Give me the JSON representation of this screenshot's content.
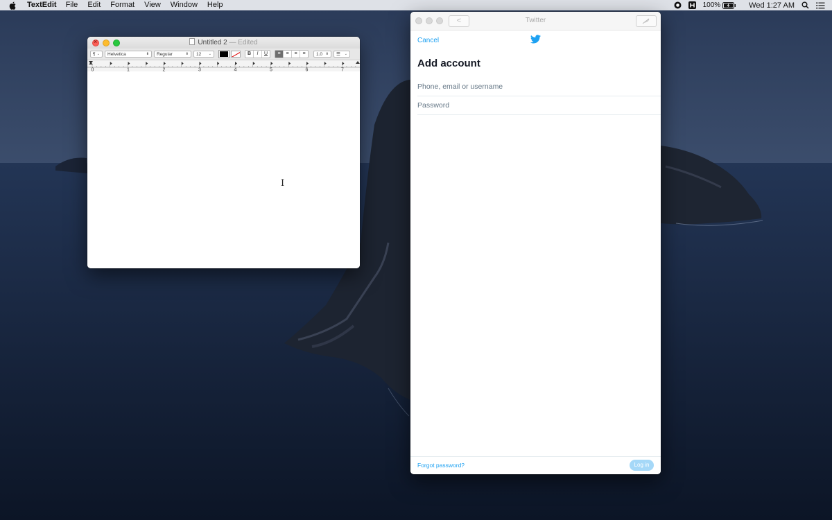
{
  "menubar": {
    "apple_icon": "apple-logo-icon",
    "app_name": "TextEdit",
    "items": [
      "File",
      "Edit",
      "Format",
      "View",
      "Window",
      "Help"
    ],
    "status_icons": [
      "screen-record-icon",
      "app-h-icon"
    ],
    "battery_percent": "100%",
    "battery_icon": "battery-charging-icon",
    "clock": "Wed 1:27 AM",
    "search_icon": "spotlight-search-icon",
    "control_icon": "notification-center-icon"
  },
  "textedit": {
    "title": "Untitled 2",
    "edited_label": "— Edited",
    "toolbar": {
      "paragraph_style": "¶",
      "font_family": "Helvetica",
      "font_style": "Regular",
      "font_size": "12",
      "bold": "B",
      "italic": "I",
      "underline": "U",
      "line_spacing": "1.0",
      "list": "☰"
    },
    "ruler_numbers": [
      "0",
      "1",
      "2",
      "3",
      "4",
      "5",
      "6",
      "7"
    ],
    "cursor": "I"
  },
  "twitter": {
    "window_title": "Twitter",
    "back_label": "<",
    "cancel_label": "Cancel",
    "heading": "Add account",
    "phone_placeholder": "Phone, email or username",
    "password_placeholder": "Password",
    "forgot_label": "Forgot password?",
    "login_label": "Log in",
    "accent_color": "#1da1f2"
  }
}
